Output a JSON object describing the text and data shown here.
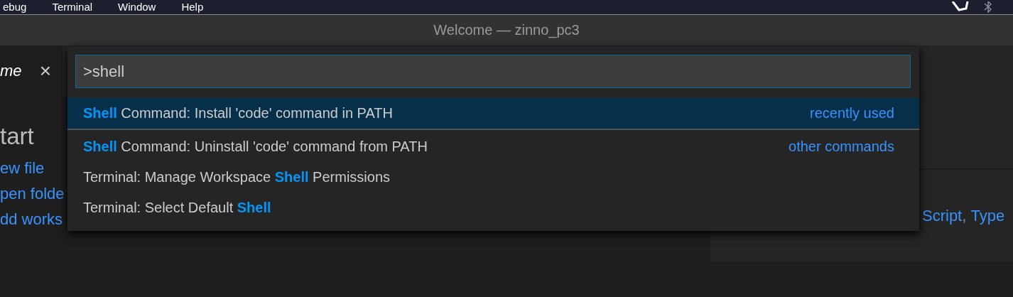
{
  "menu_bar": {
    "items": [
      "ebug",
      "Terminal",
      "Window",
      "Help"
    ]
  },
  "window": {
    "title": "Welcome — zinno_pc3"
  },
  "tabs": [
    {
      "label": "me",
      "selected": true,
      "close": "×"
    }
  ],
  "welcome": {
    "heading": "tart",
    "links": [
      "ew file",
      "pen folde",
      "dd works"
    ],
    "panel_text": [
      "Script",
      ", ",
      "Type"
    ]
  },
  "command_palette": {
    "value": ">shell",
    "items": [
      {
        "label": "**Shell** Command: Install 'code' command in PATH",
        "group": "recently used",
        "selected": true
      },
      {
        "label": "**Shell** Command: Uninstall 'code' command from PATH",
        "group": "other commands",
        "selected": false
      },
      {
        "label": "Terminal: Manage Workspace **Shell** Permissions",
        "selected": false
      },
      {
        "label": "Terminal: Select Default **Shell**",
        "selected": false
      }
    ]
  }
}
